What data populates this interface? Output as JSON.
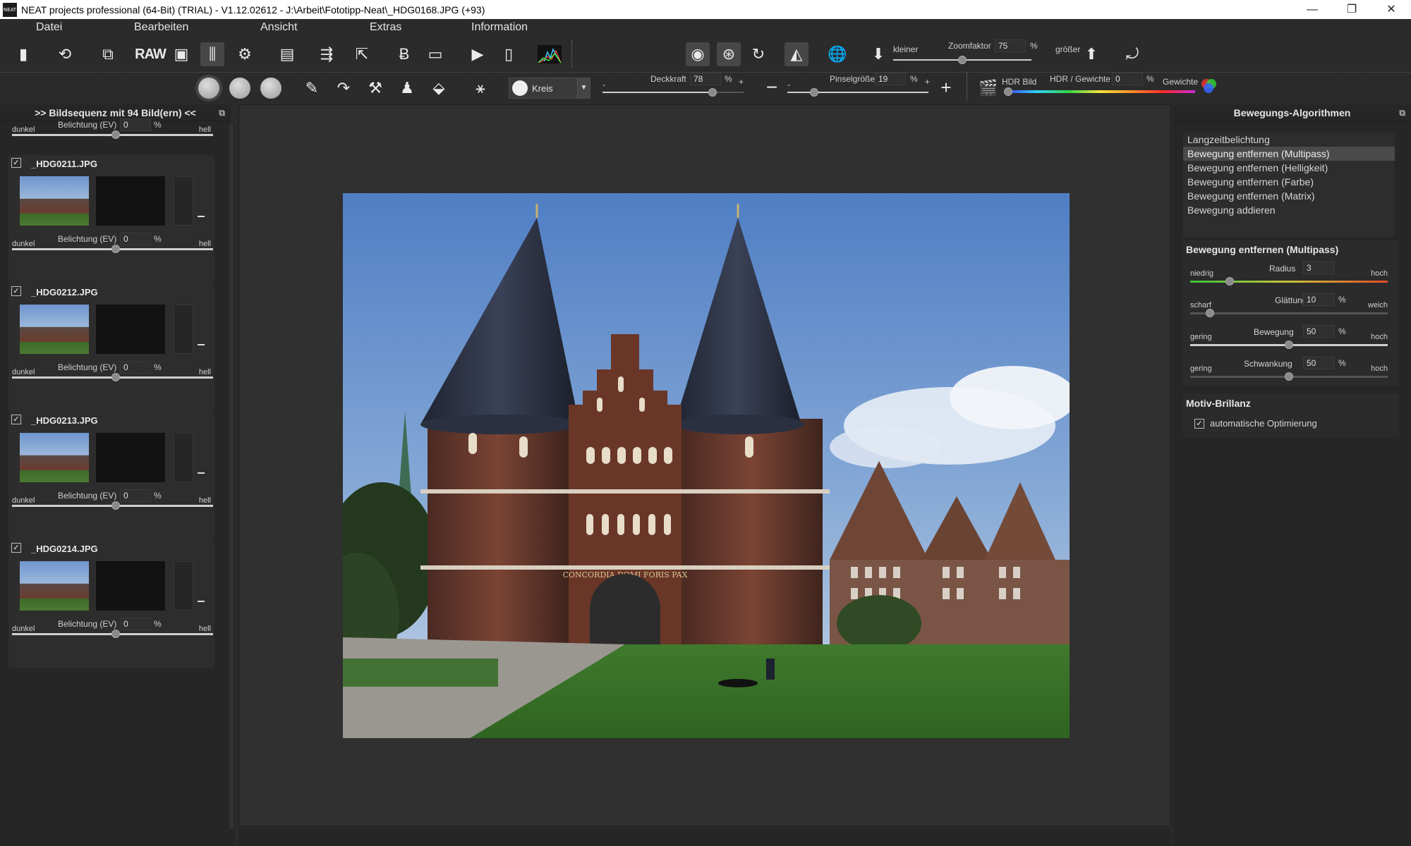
{
  "window": {
    "title": "NEAT projects professional (64-Bit) (TRIAL) - V1.12.02612 - J:\\Arbeit\\Fototipp-Neat\\_HDG0168.JPG (+93)",
    "app_icon_text": "NEAT",
    "minimize": "—",
    "restore": "❐",
    "close": "✕"
  },
  "menu": [
    "Datei",
    "Bearbeiten",
    "Ansicht",
    "Extras",
    "Information"
  ],
  "toolbar1": {
    "raw_label": "RAW",
    "zoom": {
      "label": "Zoomfaktor",
      "value": "75",
      "unit": "%",
      "smaller": "kleiner",
      "larger": "größer",
      "level": 0.5
    }
  },
  "toolbar2": {
    "brush_shape": "Kreis",
    "opacity": {
      "label": "Deckkraft",
      "value": "78",
      "unit": "%",
      "minus": "-",
      "plus": "+",
      "level": 0.78
    },
    "brush_size": {
      "label": "Pinselgröße",
      "value": "19",
      "unit": "%",
      "minus": "-",
      "plus": "+",
      "level": 0.19,
      "minus_btn": "−",
      "plus_btn": "+"
    },
    "hdr_label": "HDR Bild",
    "hdr_weight": {
      "label": "HDR / Gewichte",
      "value": "0",
      "unit": "%",
      "weights_label": "Gewichte"
    }
  },
  "left_panel": {
    "title": ">> Bildsequenz mit 94 Bild(ern) <<",
    "pin": "⧉",
    "exposure_dark": "dunkel",
    "exposure_label": "Belichtung (EV)",
    "exposure_unit": "%",
    "exposure_bright": "hell",
    "top_exposure_value": "0",
    "frames": [
      {
        "name": "_HDG0211.JPG",
        "checked": true,
        "exposure": "0"
      },
      {
        "name": "_HDG0212.JPG",
        "checked": true,
        "exposure": "0"
      },
      {
        "name": "_HDG0213.JPG",
        "checked": true,
        "exposure": "0"
      },
      {
        "name": "_HDG0214.JPG",
        "checked": true,
        "exposure": "0"
      }
    ]
  },
  "right_panel": {
    "title": "Bewegungs-Algorithmen",
    "pin": "⧉",
    "algorithms": [
      "Langzeitbelichtung",
      "Bewegung entfernen (Multipass)",
      "Bewegung entfernen (Helligkeit)",
      "Bewegung entfernen (Farbe)",
      "Bewegung entfernen (Matrix)",
      "Bewegung addieren"
    ],
    "selected_algorithm": 1,
    "params_title": "Bewegung entfernen (Multipass)",
    "params": [
      {
        "name": "Radius",
        "value": "3",
        "unit": "",
        "low": "niedrig",
        "high": "hoch",
        "level": 0.2
      },
      {
        "name": "Glättung",
        "value": "10",
        "unit": "%",
        "low": "scharf",
        "high": "weich",
        "level": 0.1
      },
      {
        "name": "Bewegung",
        "value": "50",
        "unit": "%",
        "low": "gering",
        "high": "hoch",
        "level": 0.5
      },
      {
        "name": "Schwankung",
        "value": "50",
        "unit": "%",
        "low": "gering",
        "high": "hoch",
        "level": 0.5
      }
    ],
    "brilliance_title": "Motiv-Brillanz",
    "auto_opt_label": "automatische Optimierung",
    "auto_opt_checked": true
  },
  "photo_text": "CONCORDIA DOMI FORIS PAX",
  "colors": {
    "bg": "#2b2b2b",
    "panel": "#262626",
    "canvas": "#303030"
  }
}
